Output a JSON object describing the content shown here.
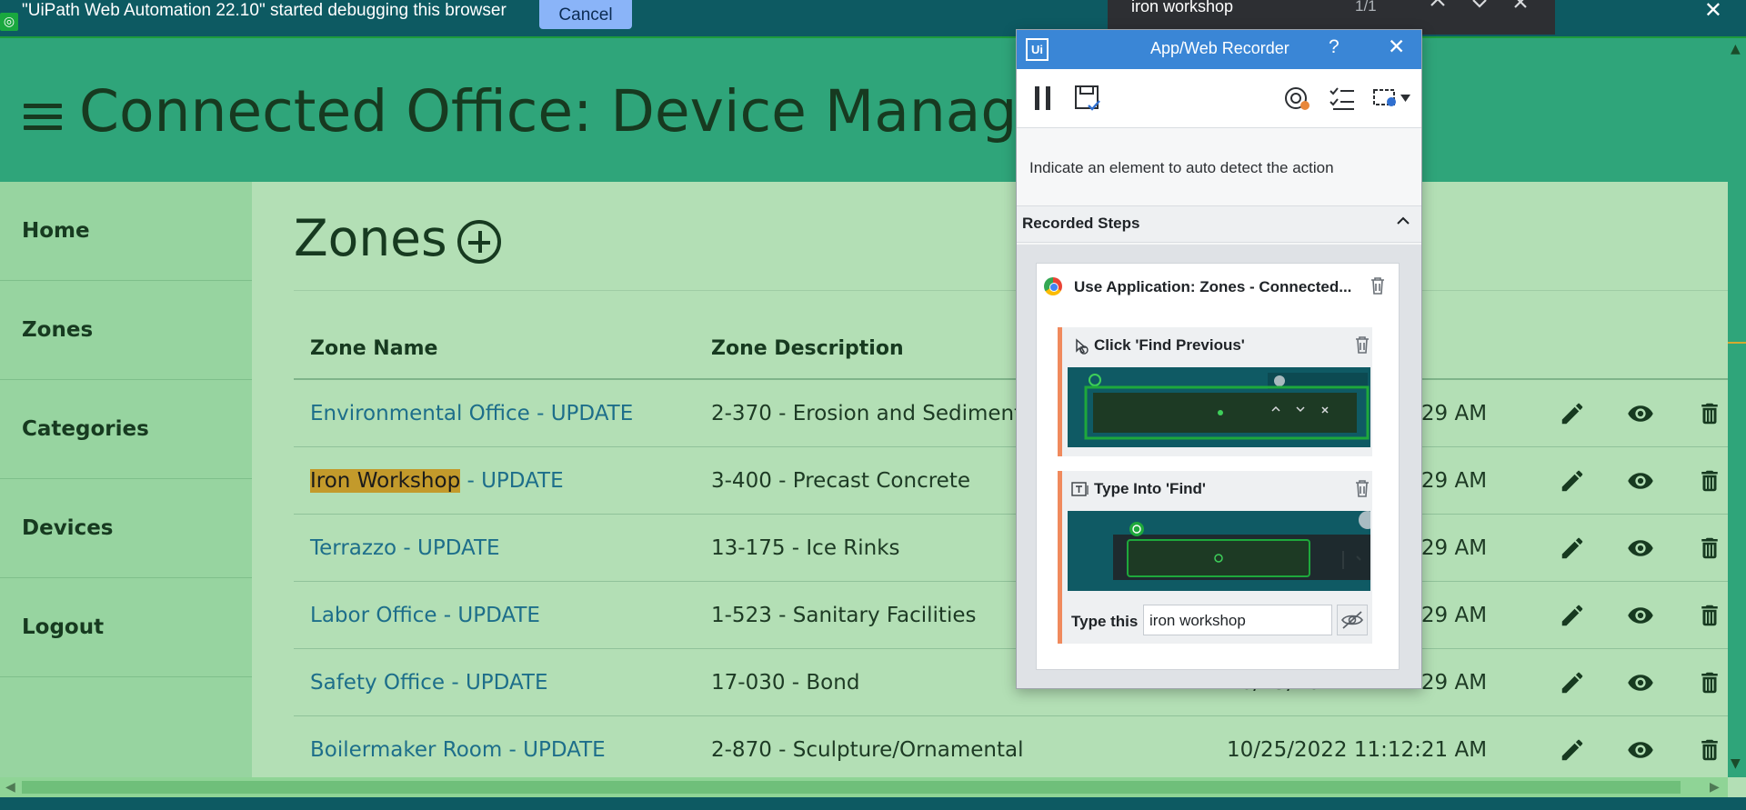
{
  "debug_bar": {
    "message": "\"UiPath Web Automation 22.10\" started debugging this browser",
    "cancel_label": "Cancel",
    "close_label": "✕"
  },
  "find_bar": {
    "query": "iron workshop",
    "count": "1/1"
  },
  "header": {
    "title": "Connected Office: Device Management"
  },
  "sidebar": {
    "items": [
      {
        "label": "Home"
      },
      {
        "label": "Zones"
      },
      {
        "label": "Categories"
      },
      {
        "label": "Devices"
      },
      {
        "label": "Logout"
      }
    ]
  },
  "main": {
    "title": "Zones",
    "columns": [
      "Zone Name",
      "Zone Description"
    ],
    "rows": [
      {
        "name_hl": "",
        "name": "Environmental Office - UPDATE",
        "desc": "2-370 - Erosion and Sedimentation",
        "date": "10/25/2022 11:12:29 AM"
      },
      {
        "name_hl": "Iron Workshop",
        "name": " - UPDATE",
        "desc": "3-400 - Precast Concrete",
        "date": "10/25/2022 11:12:29 AM"
      },
      {
        "name_hl": "",
        "name": "Terrazzo - UPDATE",
        "desc": "13-175 - Ice Rinks",
        "date": "10/25/2022 11:12:29 AM"
      },
      {
        "name_hl": "",
        "name": "Labor Office - UPDATE",
        "desc": "1-523 - Sanitary Facilities",
        "date": "10/25/2022 11:12:29 AM"
      },
      {
        "name_hl": "",
        "name": "Safety Office - UPDATE",
        "desc": "17-030 - Bond",
        "date": "10/25/2022 11:12:29 AM"
      },
      {
        "name_hl": "",
        "name": "Boilermaker Room - UPDATE",
        "desc": "2-870 - Sculpture/Ornamental",
        "date": "10/25/2022 11:12:21 AM"
      }
    ]
  },
  "recorder": {
    "logo": "Ui",
    "title": "App/Web Recorder",
    "help": "?",
    "close": "✕",
    "hint": "Indicate an element to auto detect the action",
    "steps_header": "Recorded Steps",
    "use_app_label": "Use Application: Zones - Connected...",
    "steps": [
      {
        "label": "Click 'Find Previous'"
      },
      {
        "label": "Type Into 'Find'"
      }
    ],
    "type_label": "Type this",
    "type_value": "iron workshop"
  },
  "colors": {
    "header": "#2fa57a",
    "page": "#b3dfb5",
    "sidebar": "#97d4a0",
    "link": "#1d6e8a",
    "highlight": "#c39a2b",
    "recorder_accent": "#3a86d6",
    "step_accent": "#f08a5d"
  }
}
